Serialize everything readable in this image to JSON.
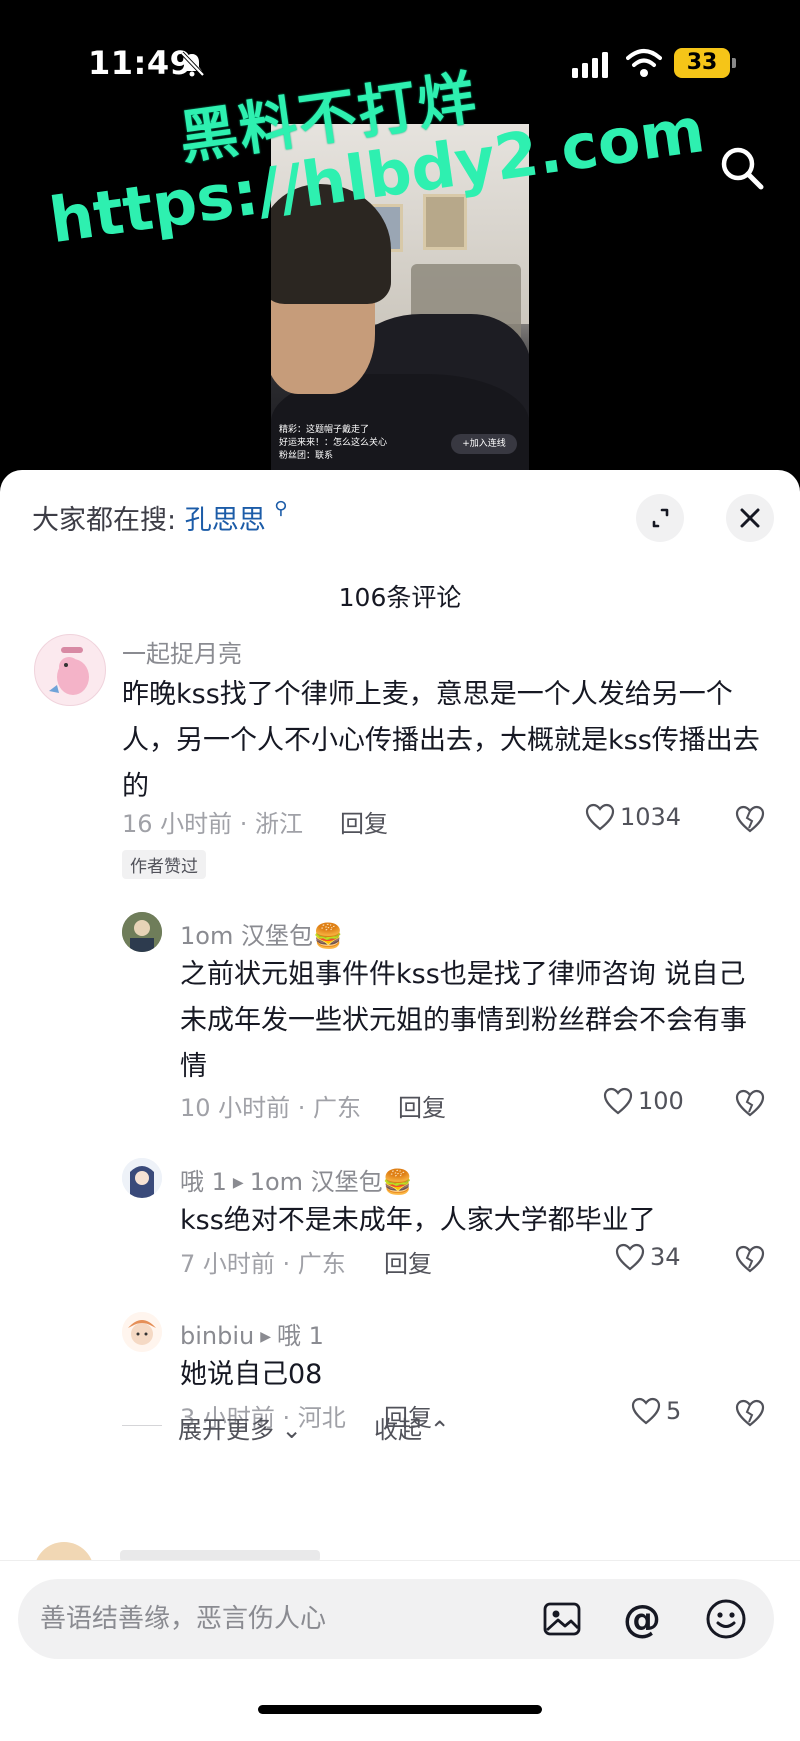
{
  "status": {
    "time": "11:49",
    "battery": "33"
  },
  "watermark": {
    "line1": "黑料不打烊",
    "line2": "https://hlbdy2.com"
  },
  "video": {
    "comments": [
      "精彩：这题帽子戴走了",
      "好运来来！：怎么这么关心",
      "粉丝团：联系"
    ],
    "join_label": "+加入连线"
  },
  "sheet": {
    "hot_search_label": "大家都在搜:",
    "hot_search_keyword": "孔思思",
    "comment_count": "106条评论"
  },
  "comments": [
    {
      "name": "一起捉月亮",
      "text": "昨晚kss找了个律师上麦，意思是一个人发给另一个人，另一个人不小心传播出去，大概就是kss传播出去的",
      "meta": "16 小时前 · 浙江",
      "reply": "回复",
      "likes": "1034",
      "tag": "作者赞过"
    },
    {
      "name": "1om 汉堡包🍔",
      "text": "之前状元姐事件件kss也是找了律师咨询 说自己未成年发一些状元姐的事情到粉丝群会不会有事情",
      "meta": "10 小时前 · 广东",
      "reply": "回复",
      "likes": "100"
    },
    {
      "name": "哦 1",
      "reply_to": "1om 汉堡包🍔",
      "text": "kss绝对不是未成年，人家大学都毕业了",
      "meta": "7 小时前 · 广东",
      "reply": "回复",
      "likes": "34"
    },
    {
      "name": "binbiu",
      "reply_to": "哦 1",
      "text": "她说自己08",
      "meta": "3 小时前 · 河北",
      "reply": "回复",
      "likes": "5"
    }
  ],
  "expand": {
    "more": "展开更多",
    "collapse": "收起"
  },
  "input": {
    "placeholder": "善语结善缘，恶言伤人心"
  }
}
